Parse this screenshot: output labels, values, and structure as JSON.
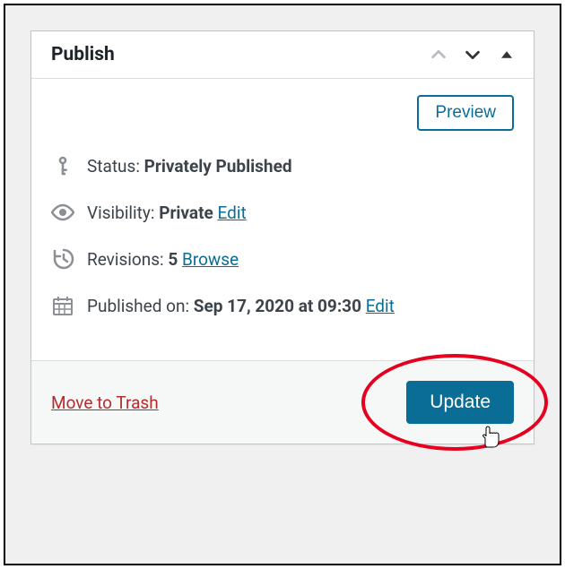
{
  "panel": {
    "title": "Publish",
    "preview_label": "Preview",
    "status": {
      "label": "Status:",
      "value": "Privately Published"
    },
    "visibility": {
      "label": "Visibility:",
      "value": "Private",
      "edit": "Edit"
    },
    "revisions": {
      "label": "Revisions:",
      "count": "5",
      "browse": "Browse"
    },
    "published": {
      "label": "Published on:",
      "value": "Sep 17, 2020 at 09:30",
      "edit": "Edit"
    },
    "trash": "Move to Trash",
    "update": "Update"
  }
}
